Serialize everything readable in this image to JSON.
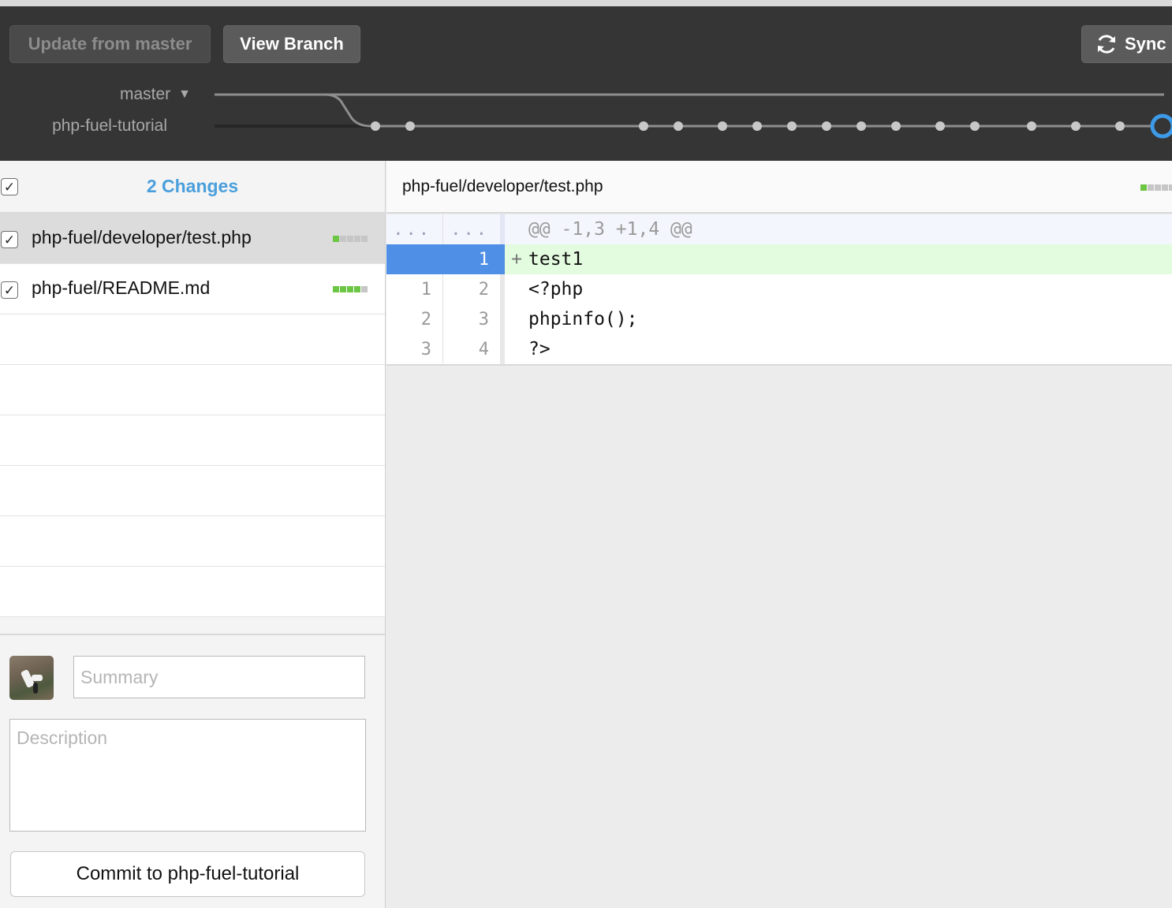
{
  "header": {
    "update_label": "Update from master",
    "view_branch_label": "View Branch",
    "sync_label": "Sync",
    "master_branch": "master",
    "current_branch": "php-fuel-tutorial"
  },
  "changes": {
    "title": "2 Changes",
    "files": [
      {
        "name": "php-fuel/developer/test.php",
        "checked": true,
        "diffstat": [
          "added",
          "neutral",
          "neutral",
          "neutral",
          "neutral"
        ]
      },
      {
        "name": "php-fuel/README.md",
        "checked": true,
        "diffstat": [
          "added",
          "added",
          "added",
          "added",
          "neutral"
        ]
      }
    ]
  },
  "commit": {
    "summary_placeholder": "Summary",
    "description_placeholder": "Description",
    "button_label": "Commit to php-fuel-tutorial"
  },
  "diff": {
    "file": "php-fuel/developer/test.php",
    "hunk_header": "@@ -1,3 +1,4 @@",
    "hunk_old": "...",
    "hunk_new": "...",
    "lines": [
      {
        "old": "",
        "new": "1",
        "marker": "+",
        "code": "test1",
        "type": "added"
      },
      {
        "old": "1",
        "new": "2",
        "marker": "",
        "code": "<?php",
        "type": "context"
      },
      {
        "old": "2",
        "new": "3",
        "marker": "",
        "code": "phpinfo();",
        "type": "context"
      },
      {
        "old": "3",
        "new": "4",
        "marker": "",
        "code": "?>",
        "type": "context"
      }
    ]
  },
  "colors": {
    "accent_blue": "#4a9fdc",
    "added_green": "#6cc644",
    "selected_line_blue": "#4f8fe6"
  }
}
